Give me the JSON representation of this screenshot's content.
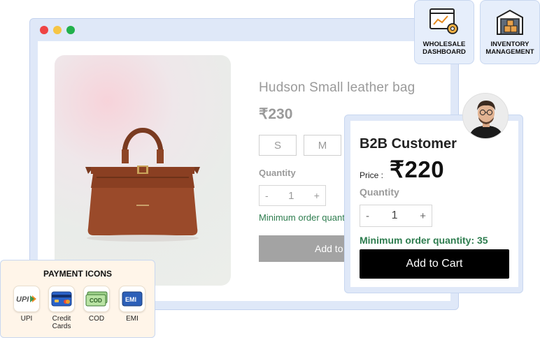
{
  "browser": {
    "window_controls": [
      "close",
      "minimize",
      "maximize"
    ]
  },
  "product": {
    "title": "Hudson Small leather bag",
    "price": "₹230",
    "sizes": [
      "S",
      "M"
    ],
    "quantity_label": "Quantity",
    "quantity_minus": "-",
    "quantity_value": "1",
    "quantity_plus": "+",
    "min_order_text": "Minimum order quantity",
    "add_to_cart_label": "Add to Cart"
  },
  "feature_cards": {
    "wholesale": {
      "label": "WHOLESALE DASHBOARD",
      "icon": "dashboard-gear-icon"
    },
    "inventory": {
      "label": "INVENTORY MANAGEMENT",
      "icon": "warehouse-icon"
    }
  },
  "b2b": {
    "title": "B2B Customer",
    "price_label": "Price :",
    "price": "₹220",
    "quantity_label": "Quantity",
    "quantity_minus": "-",
    "quantity_value": "1",
    "quantity_plus": "+",
    "min_order_text": "Minimum order quantity: 35",
    "add_to_cart_label": "Add to Cart"
  },
  "payment": {
    "title": "PAYMENT ICONS",
    "methods": [
      {
        "label": "UPI",
        "icon": "upi-icon"
      },
      {
        "label": "Credit Cards",
        "icon": "credit-card-icon"
      },
      {
        "label": "COD",
        "icon": "cash-icon"
      },
      {
        "label": "EMI",
        "icon": "emi-icon"
      }
    ],
    "tile_text": {
      "upi": "UPI",
      "cod": "COD",
      "emi": "EMI"
    }
  },
  "colors": {
    "accent_green": "#2e7d4f",
    "cart_black": "#000000",
    "panel_blue": "#dfe8f8"
  }
}
